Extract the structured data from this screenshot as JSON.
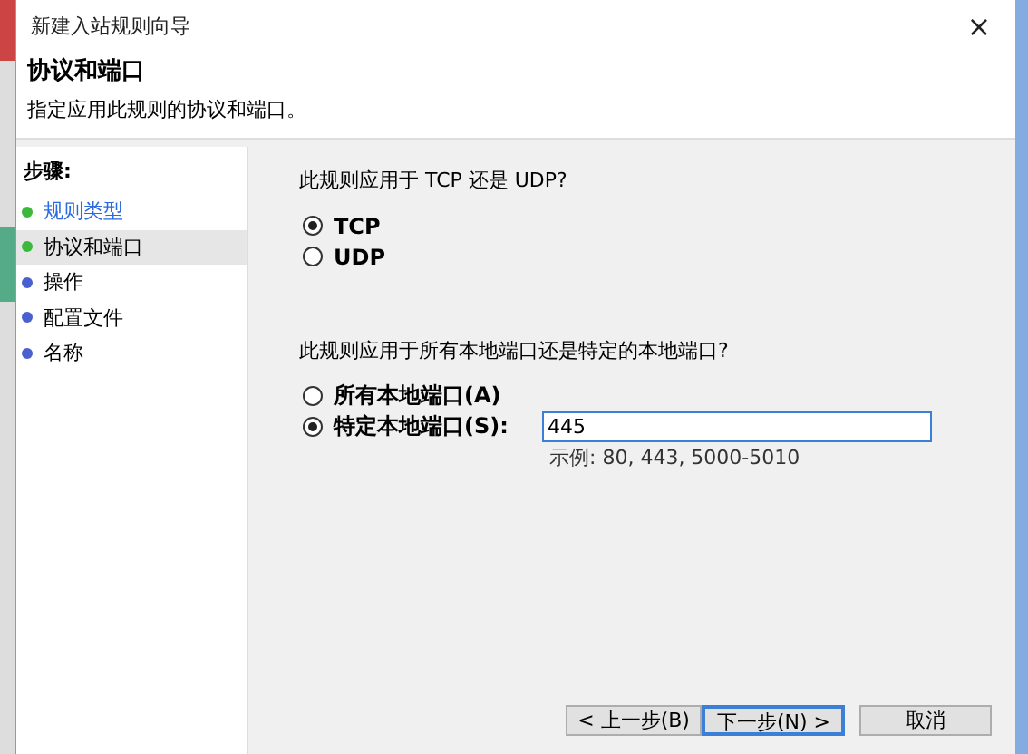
{
  "window": {
    "title": "新建入站规则向导",
    "close": "×"
  },
  "header": {
    "title": "协议和端口",
    "subtitle": "指定应用此规则的协议和端口。"
  },
  "steps": {
    "heading": "步骤:",
    "items": [
      {
        "label": "规则类型",
        "color": "#3cb83c",
        "selected": false,
        "visited": true
      },
      {
        "label": "协议和端口",
        "color": "#3cb83c",
        "selected": true,
        "visited": false
      },
      {
        "label": "操作",
        "color": "#4a5fd0",
        "selected": false,
        "visited": false
      },
      {
        "label": "配置文件",
        "color": "#4a5fd0",
        "selected": false,
        "visited": false
      },
      {
        "label": "名称",
        "color": "#4a5fd0",
        "selected": false,
        "visited": false
      }
    ]
  },
  "protocol": {
    "question": "此规则应用于 TCP 还是 UDP?",
    "options": [
      {
        "label": "TCP",
        "checked": true
      },
      {
        "label": "UDP",
        "checked": false
      }
    ]
  },
  "ports": {
    "question": "此规则应用于所有本地端口还是特定的本地端口?",
    "options": [
      {
        "label": "所有本地端口(A)",
        "checked": false
      },
      {
        "label": "特定本地端口(S):",
        "checked": true
      }
    ],
    "field": {
      "value": "445",
      "hint": "示例: 80, 443, 5000-5010"
    }
  },
  "buttons": [
    {
      "label": "< 上一步(B)",
      "focused": false
    },
    {
      "label": "下一步(N) >",
      "focused": true
    },
    {
      "label": "取消",
      "focused": false
    }
  ]
}
